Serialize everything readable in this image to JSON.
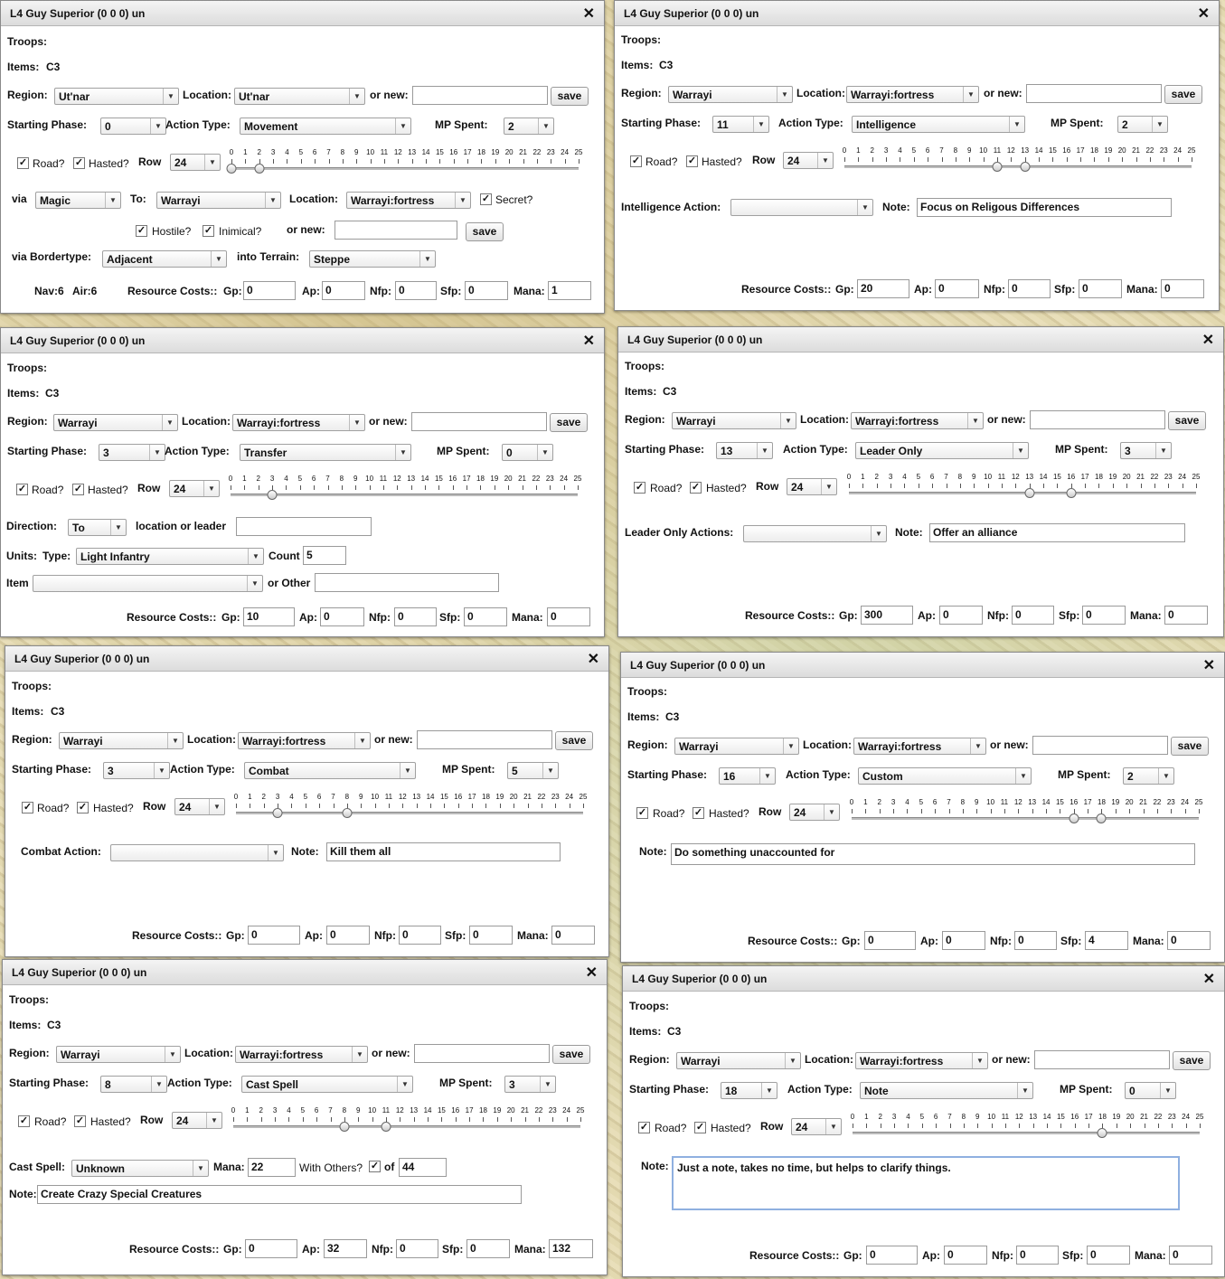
{
  "windows": [
    {
      "title": "L4 Guy Superior (0 0 0) un",
      "troops_label": "Troops:",
      "items_label": "Items:",
      "items_value": "C3",
      "region_label": "Region:",
      "region": "Ut'nar",
      "location_label": "Location:",
      "location": "Ut'nar",
      "ornew_label": "or new:",
      "save_label": "save",
      "phase_label": "Starting Phase:",
      "phase": "0",
      "action_label": "Action Type:",
      "action": "Movement",
      "mp_label": "MP Spent:",
      "mp": "2",
      "road_label": "Road?",
      "hasted_label": "Hasted?",
      "row_label": "Row",
      "row": "24",
      "slider_from": 0,
      "slider_to": 2,
      "via_label": "via",
      "via": "Magic",
      "to_label": "To:",
      "to": "Warrayi",
      "location2_label": "Location:",
      "location2": "Warrayi:fortress",
      "secret_label": "Secret?",
      "hostile_label": "Hostile?",
      "inimical_label": "Inimical?",
      "ornew2_label": "or new:",
      "save2_label": "save",
      "bordertype_label": "via Bordertype:",
      "bordertype": "Adjacent",
      "terrain_label": "into Terrain:",
      "terrain": "Steppe",
      "nav": "Nav:6",
      "air": "Air:6",
      "costs_label": "Resource Costs::",
      "gp_label": "Gp:",
      "gp": "0",
      "ap_label": "Ap:",
      "ap": "0",
      "nfp_label": "Nfp:",
      "nfp": "0",
      "sfp_label": "Sfp:",
      "sfp": "0",
      "mana_label": "Mana:",
      "mana": "1"
    },
    {
      "title": "L4 Guy Superior (0 0 0) un",
      "troops_label": "Troops:",
      "items_label": "Items:",
      "items_value": "C3",
      "region_label": "Region:",
      "region": "Warrayi",
      "location_label": "Location:",
      "location": "Warrayi:fortress",
      "ornew_label": "or new:",
      "save_label": "save",
      "phase_label": "Starting Phase:",
      "phase": "11",
      "action_label": "Action Type:",
      "action": "Intelligence",
      "mp_label": "MP Spent:",
      "mp": "2",
      "road_label": "Road?",
      "hasted_label": "Hasted?",
      "row_label": "Row",
      "row": "24",
      "slider_from": 11,
      "slider_to": 13,
      "intel_label": "Intelligence Action:",
      "intel": "",
      "note_label": "Note:",
      "note": "Focus on Religous Differences",
      "costs_label": "Resource Costs::",
      "gp_label": "Gp:",
      "gp": "20",
      "ap_label": "Ap:",
      "ap": "0",
      "nfp_label": "Nfp:",
      "nfp": "0",
      "sfp_label": "Sfp:",
      "sfp": "0",
      "mana_label": "Mana:",
      "mana": "0"
    },
    {
      "title": "L4 Guy Superior (0 0 0) un",
      "troops_label": "Troops:",
      "items_label": "Items:",
      "items_value": "C3",
      "region_label": "Region:",
      "region": "Warrayi",
      "location_label": "Location:",
      "location": "Warrayi:fortress",
      "ornew_label": "or new:",
      "save_label": "save",
      "phase_label": "Starting Phase:",
      "phase": "3",
      "action_label": "Action Type:",
      "action": "Transfer",
      "mp_label": "MP Spent:",
      "mp": "0",
      "road_label": "Road?",
      "hasted_label": "Hasted?",
      "row_label": "Row",
      "row": "24",
      "slider_from": 3,
      "slider_to": 3,
      "direction_label": "Direction:",
      "direction": "To",
      "locleader_label": "location or leader",
      "locleader": "",
      "units_label": "Units:",
      "type_label": "Type:",
      "type": "Light Infantry",
      "count_label": "Count",
      "count": "5",
      "item_label": "Item",
      "item": "",
      "other_label": "or Other",
      "other": "",
      "costs_label": "Resource Costs::",
      "gp_label": "Gp:",
      "gp": "10",
      "ap_label": "Ap:",
      "ap": "0",
      "nfp_label": "Nfp:",
      "nfp": "0",
      "sfp_label": "Sfp:",
      "sfp": "0",
      "mana_label": "Mana:",
      "mana": "0"
    },
    {
      "title": "L4 Guy Superior (0 0 0) un",
      "troops_label": "Troops:",
      "items_label": "Items:",
      "items_value": "C3",
      "region_label": "Region:",
      "region": "Warrayi",
      "location_label": "Location:",
      "location": "Warrayi:fortress",
      "ornew_label": "or new:",
      "save_label": "save",
      "phase_label": "Starting Phase:",
      "phase": "13",
      "action_label": "Action Type:",
      "action": "Leader Only",
      "mp_label": "MP Spent:",
      "mp": "3",
      "road_label": "Road?",
      "hasted_label": "Hasted?",
      "row_label": "Row",
      "row": "24",
      "slider_from": 13,
      "slider_to": 16,
      "leader_label": "Leader Only Actions:",
      "leader": "",
      "note_label": "Note:",
      "note": "Offer an alliance",
      "costs_label": "Resource Costs::",
      "gp_label": "Gp:",
      "gp": "300",
      "ap_label": "Ap:",
      "ap": "0",
      "nfp_label": "Nfp:",
      "nfp": "0",
      "sfp_label": "Sfp:",
      "sfp": "0",
      "mana_label": "Mana:",
      "mana": "0"
    },
    {
      "title": "L4 Guy Superior (0 0 0) un",
      "troops_label": "Troops:",
      "items_label": "Items:",
      "items_value": "C3",
      "region_label": "Region:",
      "region": "Warrayi",
      "location_label": "Location:",
      "location": "Warrayi:fortress",
      "ornew_label": "or new:",
      "save_label": "save",
      "phase_label": "Starting Phase:",
      "phase": "3",
      "action_label": "Action Type:",
      "action": "Combat",
      "mp_label": "MP Spent:",
      "mp": "5",
      "road_label": "Road?",
      "hasted_label": "Hasted?",
      "row_label": "Row",
      "row": "24",
      "slider_from": 3,
      "slider_to": 8,
      "combat_label": "Combat Action:",
      "combat": "",
      "note_label": "Note:",
      "note": "Kill them all",
      "costs_label": "Resource Costs::",
      "gp_label": "Gp:",
      "gp": "0",
      "ap_label": "Ap:",
      "ap": "0",
      "nfp_label": "Nfp:",
      "nfp": "0",
      "sfp_label": "Sfp:",
      "sfp": "0",
      "mana_label": "Mana:",
      "mana": "0"
    },
    {
      "title": "L4 Guy Superior (0 0 0) un",
      "troops_label": "Troops:",
      "items_label": "Items:",
      "items_value": "C3",
      "region_label": "Region:",
      "region": "Warrayi",
      "location_label": "Location:",
      "location": "Warrayi:fortress",
      "ornew_label": "or new:",
      "save_label": "save",
      "phase_label": "Starting Phase:",
      "phase": "16",
      "action_label": "Action Type:",
      "action": "Custom",
      "mp_label": "MP Spent:",
      "mp": "2",
      "road_label": "Road?",
      "hasted_label": "Hasted?",
      "row_label": "Row",
      "row": "24",
      "slider_from": 16,
      "slider_to": 18,
      "note_label": "Note:",
      "note": "Do something unaccounted for",
      "costs_label": "Resource Costs::",
      "gp_label": "Gp:",
      "gp": "0",
      "ap_label": "Ap:",
      "ap": "0",
      "nfp_label": "Nfp:",
      "nfp": "0",
      "sfp_label": "Sfp:",
      "sfp": "4",
      "mana_label": "Mana:",
      "mana": "0"
    },
    {
      "title": "L4 Guy Superior (0 0 0) un",
      "troops_label": "Troops:",
      "items_label": "Items:",
      "items_value": "C3",
      "region_label": "Region:",
      "region": "Warrayi",
      "location_label": "Location:",
      "location": "Warrayi:fortress",
      "ornew_label": "or new:",
      "save_label": "save",
      "phase_label": "Starting Phase:",
      "phase": "8",
      "action_label": "Action Type:",
      "action": "Cast Spell",
      "mp_label": "MP Spent:",
      "mp": "3",
      "road_label": "Road?",
      "hasted_label": "Hasted?",
      "row_label": "Row",
      "row": "24",
      "slider_from": 8,
      "slider_to": 11,
      "castspell_label": "Cast Spell:",
      "castspell": "Unknown",
      "spellmana_label": "Mana:",
      "spellmana": "22",
      "withothers_label": "With Others?",
      "of_label": "of",
      "of_value": "44",
      "note_label": "Note:",
      "note": "Create Crazy Special Creatures",
      "costs_label": "Resource Costs::",
      "gp_label": "Gp:",
      "gp": "0",
      "ap_label": "Ap:",
      "ap": "32",
      "nfp_label": "Nfp:",
      "nfp": "0",
      "sfp_label": "Sfp:",
      "sfp": "0",
      "mana_label": "Mana:",
      "mana": "132"
    },
    {
      "title": "L4 Guy Superior (0 0 0) un",
      "troops_label": "Troops:",
      "items_label": "Items:",
      "items_value": "C3",
      "region_label": "Region:",
      "region": "Warrayi",
      "location_label": "Location:",
      "location": "Warrayi:fortress",
      "ornew_label": "or new:",
      "save_label": "save",
      "phase_label": "Starting Phase:",
      "phase": "18",
      "action_label": "Action Type:",
      "action": "Note",
      "mp_label": "MP Spent:",
      "mp": "0",
      "road_label": "Road?",
      "hasted_label": "Hasted?",
      "row_label": "Row",
      "row": "24",
      "slider_from": 18,
      "slider_to": 18,
      "note_label": "Note:",
      "note": "Just a note, takes no time, but helps to clarify things.",
      "costs_label": "Resource Costs::",
      "gp_label": "Gp:",
      "gp": "0",
      "ap_label": "Ap:",
      "ap": "0",
      "nfp_label": "Nfp:",
      "nfp": "0",
      "sfp_label": "Sfp:",
      "sfp": "0",
      "mana_label": "Mana:",
      "mana": "0"
    }
  ],
  "slider_labels": [
    "0",
    "1",
    "2",
    "3",
    "4",
    "5",
    "6",
    "7",
    "8",
    "9",
    "10",
    "11",
    "12",
    "13",
    "14",
    "15",
    "16",
    "17",
    "18",
    "19",
    "20",
    "21",
    "22",
    "23",
    "24",
    "25"
  ],
  "icons": {
    "close": "close-icon",
    "dropdown": "chevron-down-icon",
    "checkbox": "checkmark-icon"
  }
}
